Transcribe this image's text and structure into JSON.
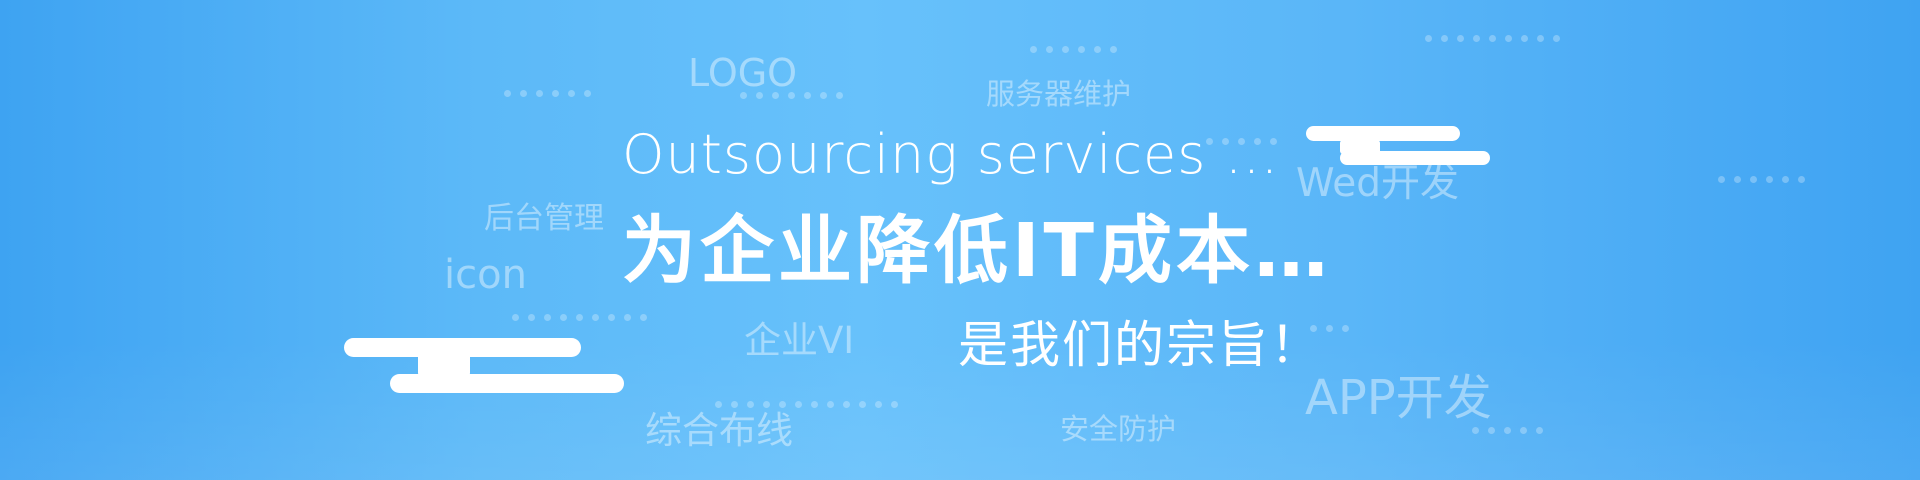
{
  "banner": {
    "headline_en": "Outsourcing services …",
    "headline_cn": "为企业降低IT成本…",
    "slogan": "是我们的宗旨！",
    "background_colors": [
      "#3ea3f2",
      "#67c1fb"
    ],
    "keywords": {
      "logo": "LOGO",
      "server_maintenance": "服务器维护",
      "web_dev": "Wed开发",
      "backend_admin": "后台管理",
      "icon": "icon",
      "enterprise_vi": "企业VI",
      "app_dev": "APP开发",
      "cabling": "综合布线",
      "security": "安全防护"
    },
    "decorations": [
      "cloud-bars-icon",
      "dotted-line-icon"
    ]
  }
}
